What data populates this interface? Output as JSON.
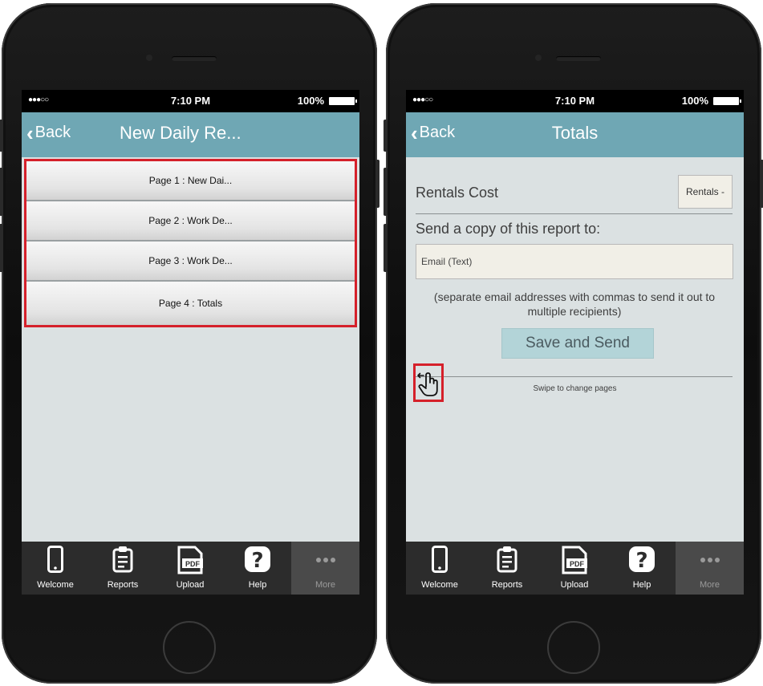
{
  "status_bar": {
    "signal": "●●●○○",
    "time": "7:10 PM",
    "battery": "100%"
  },
  "left_screen": {
    "back_label": "Back",
    "title": "New Daily Re...",
    "pages": [
      "Page 1 : New Dai...",
      "Page 2 : Work De...",
      "Page 3 : Work De...",
      "Page 4 : Totals"
    ]
  },
  "right_screen": {
    "back_label": "Back",
    "title": "Totals",
    "rentals_label": "Rentals Cost",
    "rentals_value": "Rentals -",
    "send_label": "Send a copy of this report to:",
    "email_placeholder": "Email (Text)",
    "hint": "(separate email addresses with commas to send it out to multiple recipients)",
    "save_button": "Save and Send",
    "swipe_text": "Swipe to change pages"
  },
  "tabbar": {
    "tabs": [
      "Welcome",
      "Reports",
      "Upload",
      "Help",
      "More"
    ],
    "pdf_label": "PDF"
  },
  "colors": {
    "navbar": "#6fa7b4",
    "screen_bg": "#dbe1e2",
    "highlight": "#d5202a",
    "save_button": "#b3d4d8",
    "tabbar": "#2c2c2c"
  }
}
